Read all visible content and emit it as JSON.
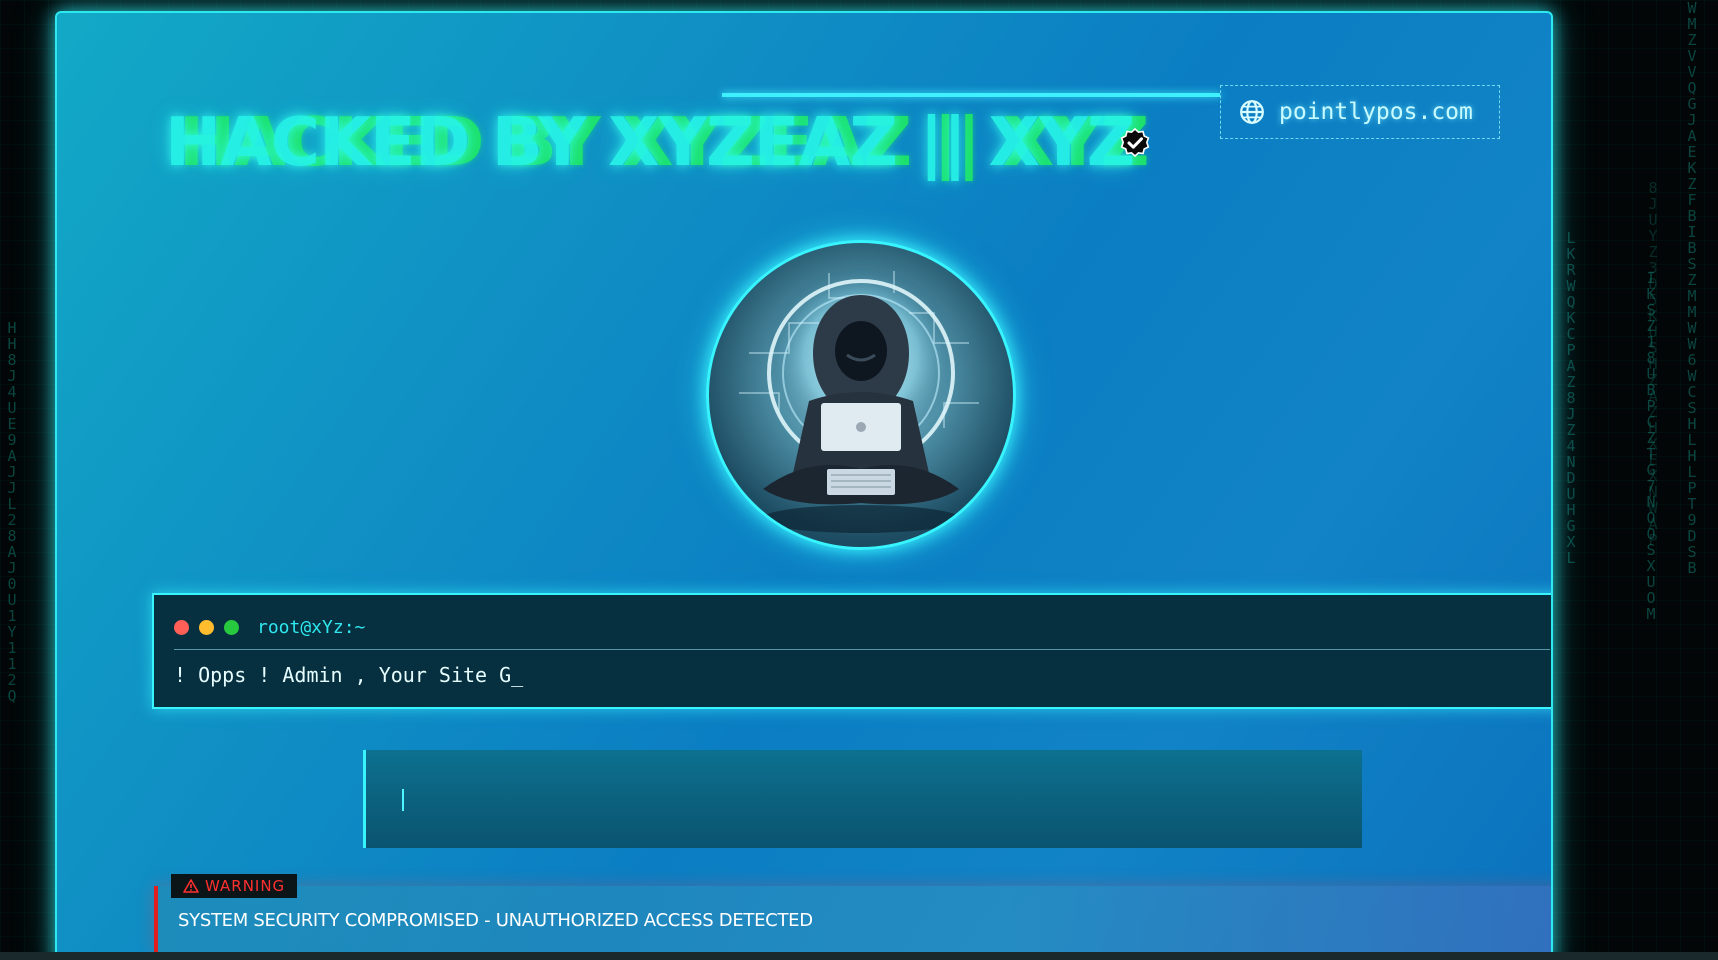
{
  "background": {
    "matrix_columns": [
      "HH8J4UE9AJJL28AJ0U1Y112Q",
      "LKRWQKCPAZ8JZ4NDUHGXL",
      "8JUYZ3D5KUSHZAZHXEXNWAP",
      "IKSZ18UBPCZTG7NOOSXUOM",
      "WMZVVQGJAEKZFBIBSZMMWW6WCSHLHLPT9DSB"
    ]
  },
  "header": {
    "title": "HACKED BY XYZEAZ || XYZ",
    "verified_icon": "verified-check-icon",
    "domain_icon": "globe-icon",
    "domain": "pointlypos.com"
  },
  "avatar": {
    "icon": "hooded-hacker-laptop"
  },
  "terminal": {
    "prompt": "root@xYz:~",
    "output": "! Opps ! Admin , Your Site G_"
  },
  "input": {
    "value": ""
  },
  "alert": {
    "tag": "WARNING",
    "tag_icon": "warning-triangle-icon",
    "message": "SYSTEM SECURITY COMPROMISED - UNAUTHORIZED ACCESS DETECTED"
  },
  "colors": {
    "accent": "#38f4ff",
    "title_green": "#1ee06a",
    "title_cyan": "#27f5e8",
    "warning": "#ff3030"
  }
}
